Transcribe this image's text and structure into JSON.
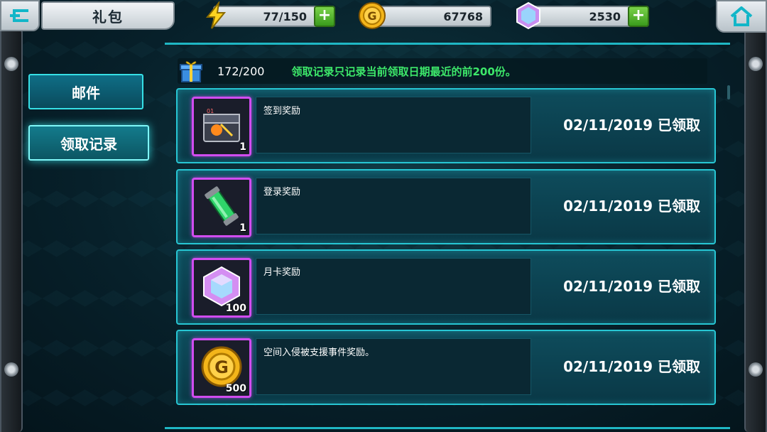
{
  "header": {
    "title": "礼包",
    "energy": "77/150",
    "gold": "67768",
    "gems": "2530"
  },
  "tabs": [
    {
      "label": "邮件"
    },
    {
      "label": "领取记录"
    }
  ],
  "info": {
    "count": "172/200",
    "notice": "领取记录只记录当前领取日期最近的前200份。"
  },
  "records": [
    {
      "title": "签到奖励",
      "qty": "1",
      "status": "02/11/2019 已领取",
      "icon": "treasure-box-icon"
    },
    {
      "title": "登录奖励",
      "qty": "1",
      "status": "02/11/2019 已领取",
      "icon": "green-capsule-icon"
    },
    {
      "title": "月卡奖励",
      "qty": "100",
      "status": "02/11/2019 已领取",
      "icon": "gem-icon"
    },
    {
      "title": "空间入侵被支援事件奖励。",
      "qty": "500",
      "status": "02/11/2019 已领取",
      "icon": "gold-coin-icon"
    }
  ],
  "colors": {
    "accent": "#27c6d3",
    "notice": "#3de86a",
    "slot_border": "#d14cf0"
  }
}
